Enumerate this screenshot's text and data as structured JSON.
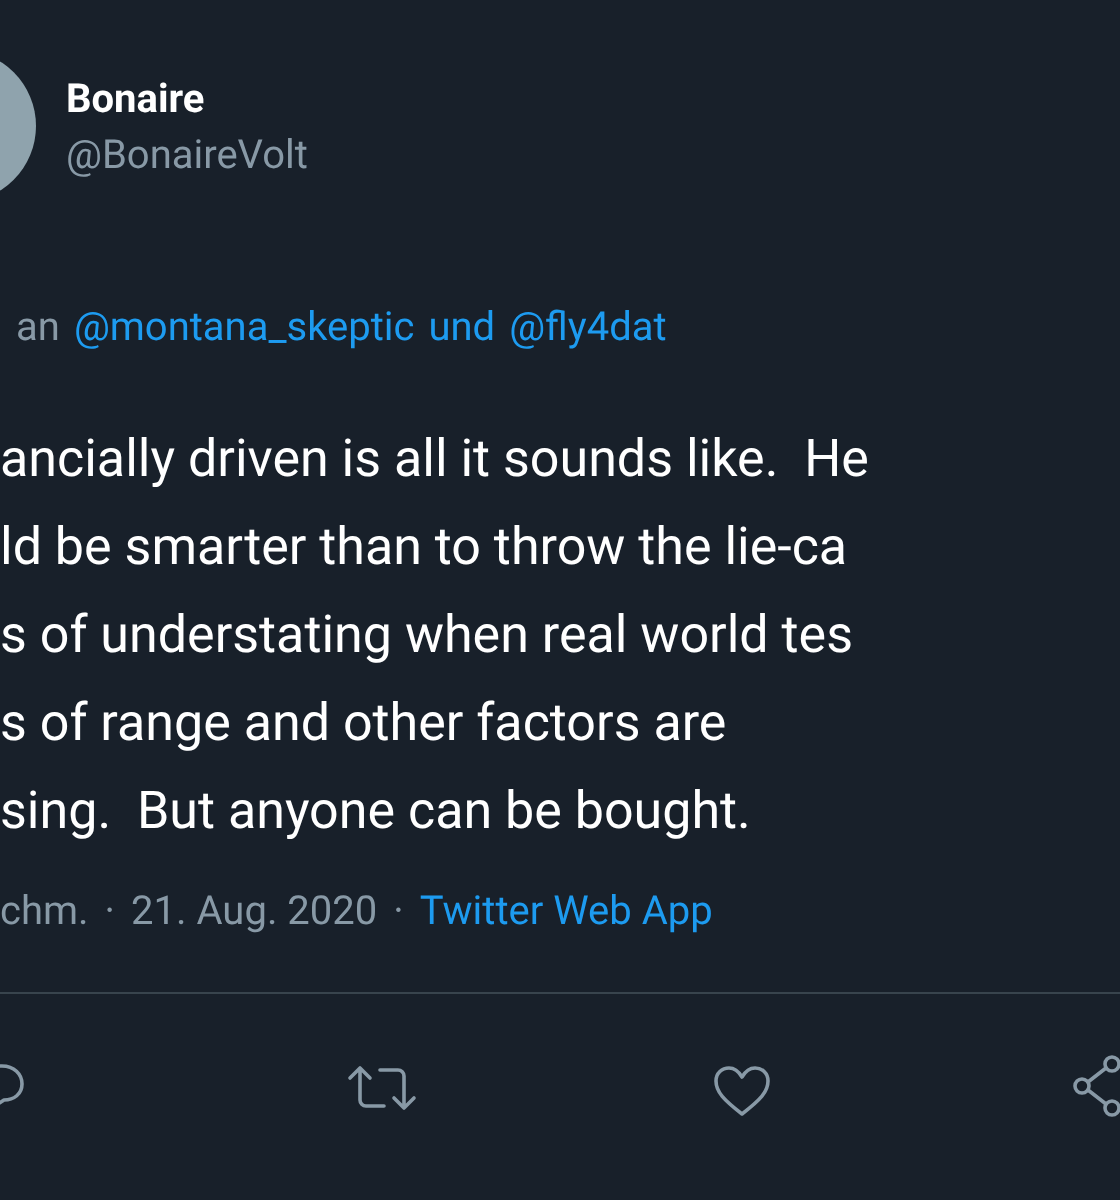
{
  "author": {
    "name": "Bonaire",
    "handle": "@BonaireVolt"
  },
  "reply_to": {
    "prefix": "an",
    "mentions": [
      "@montana_skeptic",
      "@fly4dat"
    ],
    "joiner": "und"
  },
  "body_lines": [
    "ancially driven is all it sounds like.  He",
    "ld be smarter than to throw the lie-ca",
    "s of understating when real world tes",
    "s of range and other factors are",
    "sing.  But anyone can be bought."
  ],
  "meta": {
    "separator": "·",
    "time": "chm.",
    "date": "21. Aug. 2020",
    "source": "Twitter Web App"
  }
}
